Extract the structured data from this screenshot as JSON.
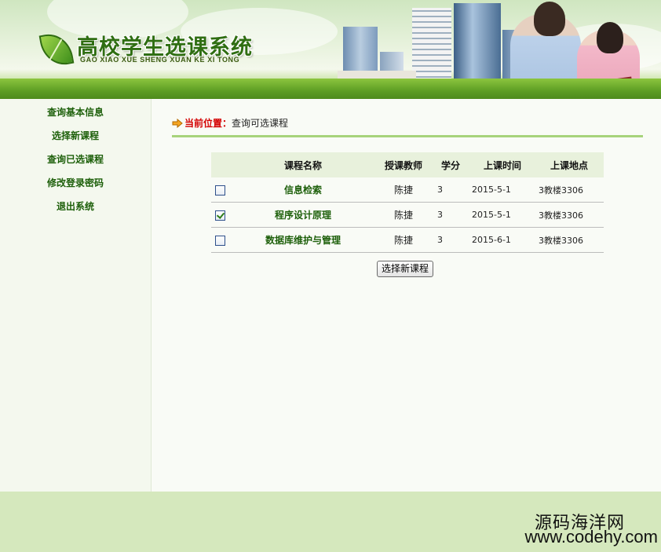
{
  "header": {
    "title": "高校学生选课系统",
    "subtitle": "GAO XIAO XUE SHENG XUAN KE XI TONG"
  },
  "sidebar": {
    "items": [
      {
        "label": "查询基本信息"
      },
      {
        "label": "选择新课程"
      },
      {
        "label": "查询已选课程"
      },
      {
        "label": "修改登录密码"
      },
      {
        "label": "退出系统"
      }
    ]
  },
  "location": {
    "label": "当前位置：",
    "value": "查询可选课程"
  },
  "table": {
    "columns": [
      "课程名称",
      "授课教师",
      "学分",
      "上课时间",
      "上课地点"
    ],
    "rows": [
      {
        "checked": false,
        "name": "信息检索",
        "teacher": "陈捷",
        "credit": "3",
        "time": "2015-5-1",
        "place": "3教楼3306"
      },
      {
        "checked": true,
        "name": "程序设计原理",
        "teacher": "陈捷",
        "credit": "3",
        "time": "2015-5-1",
        "place": "3教楼3306"
      },
      {
        "checked": false,
        "name": "数据库维护与管理",
        "teacher": "陈捷",
        "credit": "3",
        "time": "2015-6-1",
        "place": "3教楼3306"
      }
    ]
  },
  "submit_label": "选择新课程",
  "watermark": {
    "line1": "源码海洋网",
    "line2": "www.codehy.com"
  },
  "colors": {
    "accent_green": "#1d5f0a",
    "location_label": "#d40000",
    "divider": "#a7d37b",
    "footer_bg": "#d5e8bd"
  }
}
